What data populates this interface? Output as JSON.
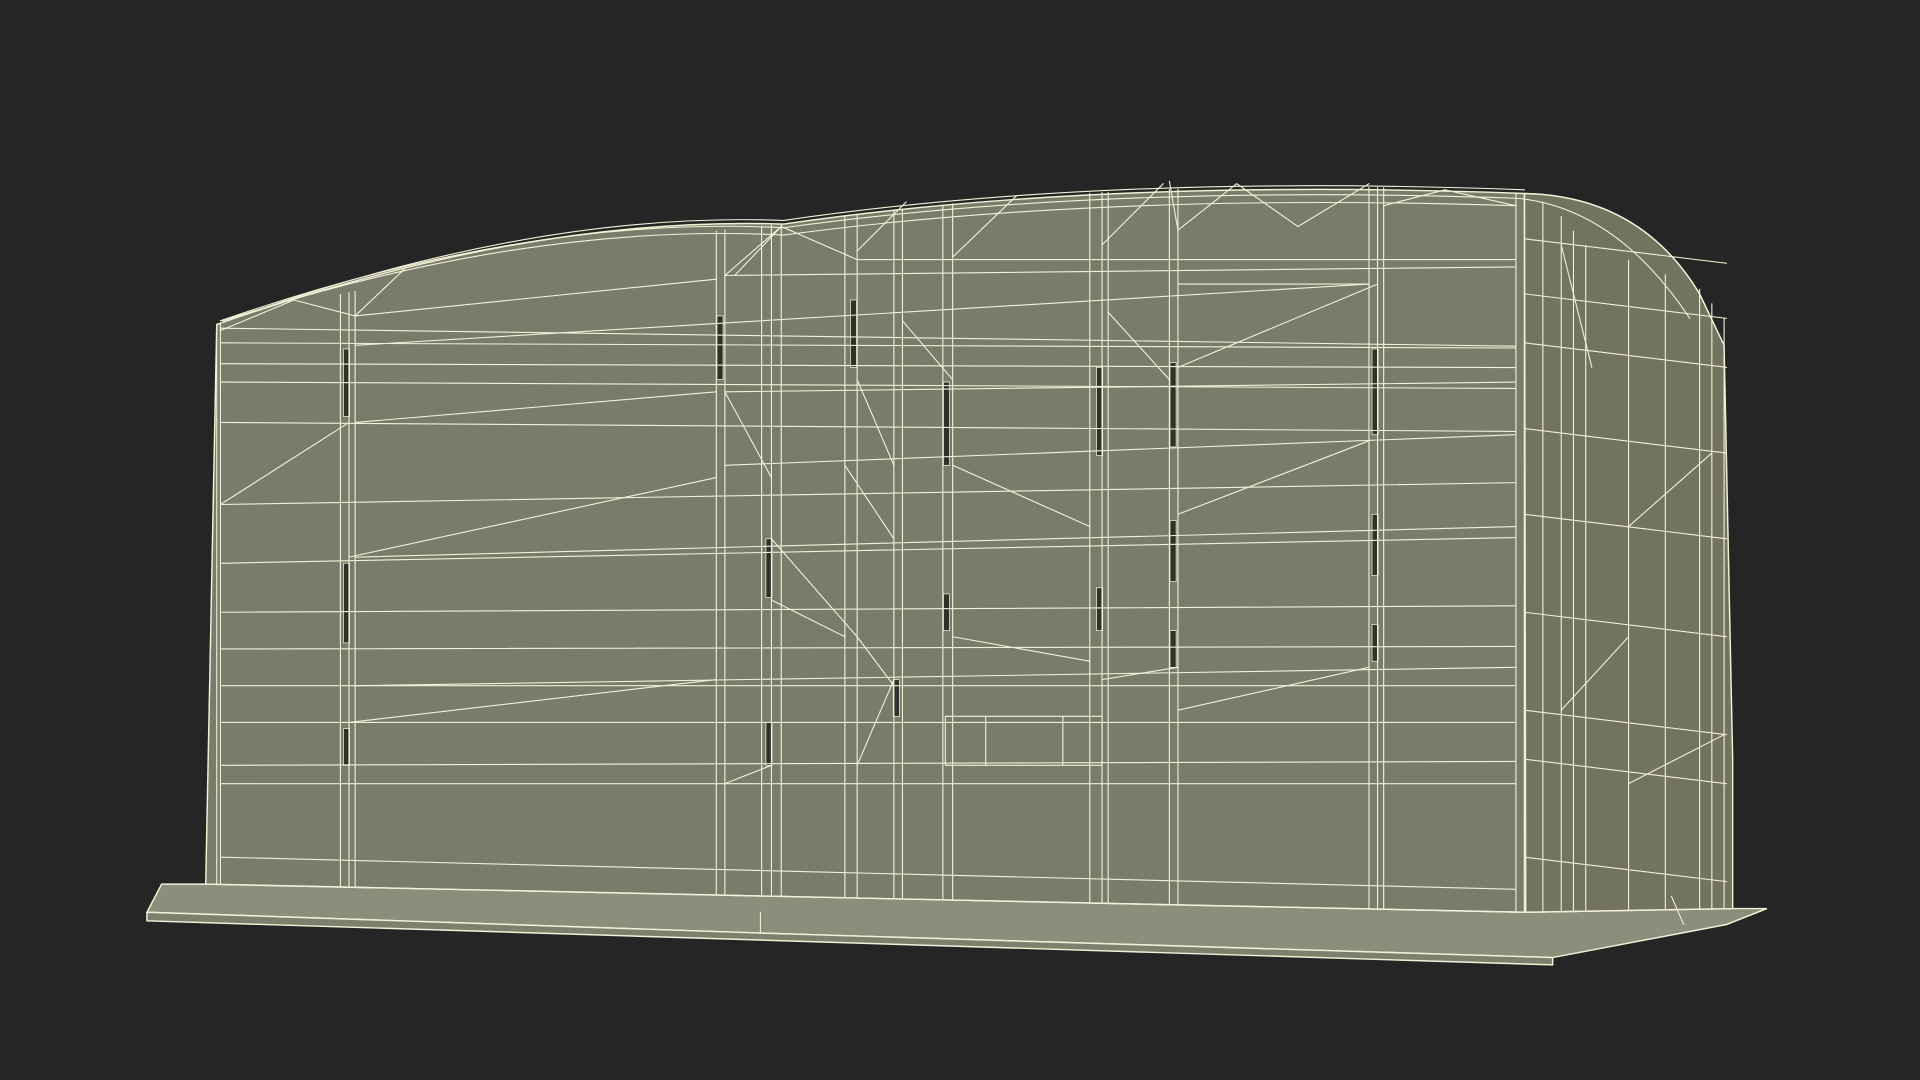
{
  "scene": {
    "subject": "wireframe-render",
    "colors": {
      "background": "#252525",
      "surface": "#7a7c6b",
      "surface_shade": "#72745f",
      "wire": "#f2f1d8",
      "base_front": "#7e806e",
      "base_top": "#8c8e7c",
      "slot": "#2f312a"
    }
  }
}
